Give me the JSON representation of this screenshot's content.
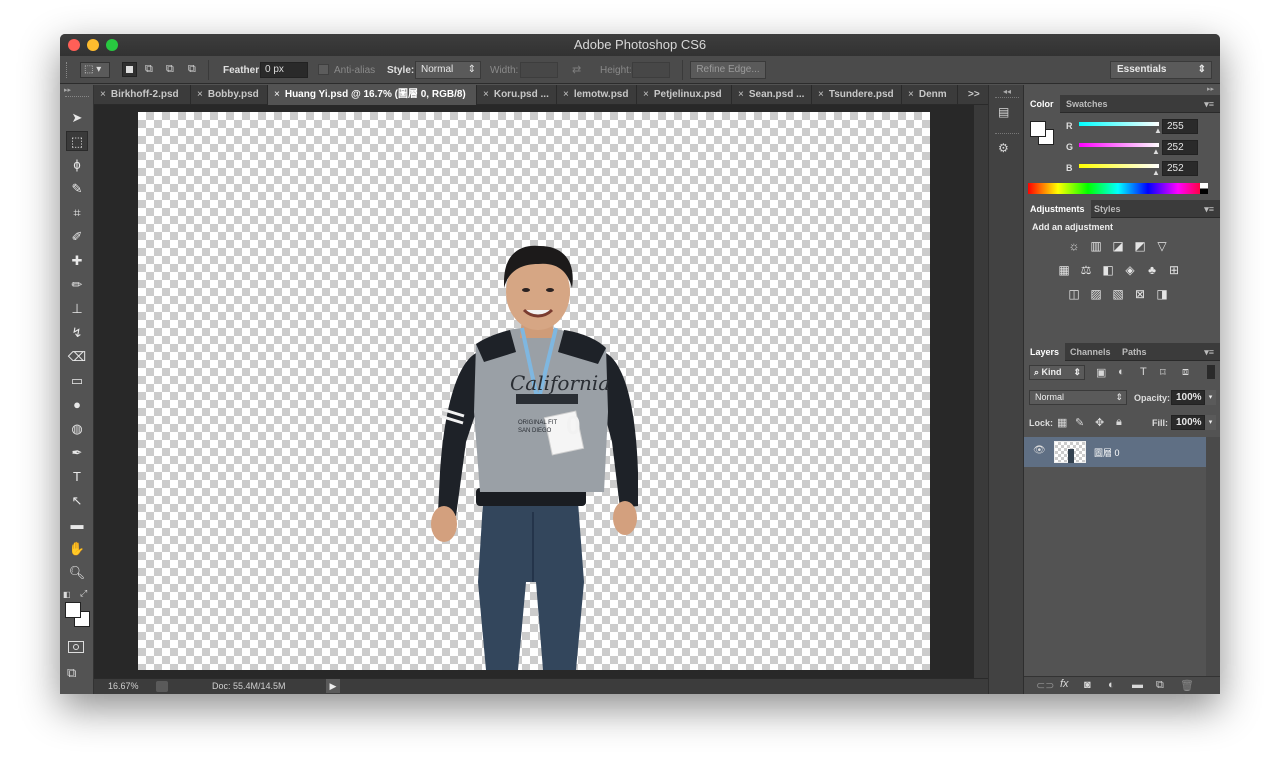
{
  "window": {
    "title": "Adobe Photoshop CS6"
  },
  "options": {
    "feather_label": "Feather:",
    "feather_value": "0 px",
    "antialias_label": "Anti-alias",
    "style_label": "Style:",
    "style_value": "Normal",
    "width_label": "Width:",
    "height_label": "Height:",
    "refine_edge": "Refine Edge...",
    "workspace": "Essentials"
  },
  "tabs": [
    {
      "label": "Birkhoff-2.psd"
    },
    {
      "label": "Bobby.psd"
    },
    {
      "label": "Huang Yi.psd @ 16.7% (圖層 0, RGB/8)"
    },
    {
      "label": "Koru.psd ..."
    },
    {
      "label": "lemotw.psd"
    },
    {
      "label": "Petjelinux.psd"
    },
    {
      "label": "Sean.psd ..."
    },
    {
      "label": "Tsundere.psd"
    },
    {
      "label": "Denm"
    }
  ],
  "tab_overflow": ">>",
  "status": {
    "zoom": "16.67%",
    "doc": "Doc: 55.4M/14.5M"
  },
  "color_panel": {
    "tabs": [
      "Color",
      "Swatches"
    ],
    "r_label": "R",
    "r_value": "255",
    "g_label": "G",
    "g_value": "252",
    "b_label": "B",
    "b_value": "252"
  },
  "adjustments_panel": {
    "tabs": [
      "Adjustments",
      "Styles"
    ],
    "heading": "Add an adjustment"
  },
  "layers_panel": {
    "tabs": [
      "Layers",
      "Channels",
      "Paths"
    ],
    "kind": "Kind",
    "blend_mode": "Normal",
    "opacity_label": "Opacity:",
    "opacity_value": "100%",
    "lock_label": "Lock:",
    "fill_label": "Fill:",
    "fill_value": "100%",
    "layer_name": "圖層 0"
  },
  "colors": {
    "accent_layer": "#5f6f84",
    "foreground": "#ffffff",
    "background": "#ffffff"
  }
}
